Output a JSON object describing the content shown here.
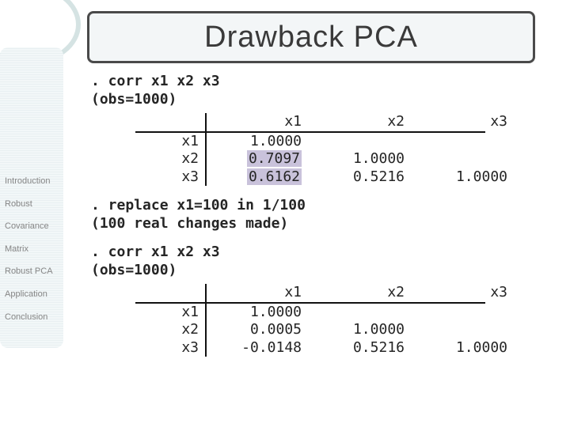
{
  "title": "Drawback PCA",
  "sidebar": {
    "items": [
      "Introduction",
      "Robust",
      "Covariance",
      "Matrix",
      "Robust PCA",
      "Application",
      "Conclusion"
    ]
  },
  "content": {
    "cmd1_line1": ". corr x1 x2 x3",
    "cmd1_line2": "(obs=1000)",
    "table1": {
      "col_headers": [
        "x1",
        "x2",
        "x3"
      ],
      "rows": [
        {
          "label": "x1",
          "vals": [
            "1.0000",
            "",
            ""
          ]
        },
        {
          "label": "x2",
          "vals": [
            "0.7097",
            "1.0000",
            ""
          ]
        },
        {
          "label": "x3",
          "vals": [
            "0.6162",
            "0.5216",
            "1.0000"
          ]
        }
      ],
      "highlight_cells": [
        "r1c0",
        "r2c0"
      ]
    },
    "cmd2_line1": ". replace x1=100 in 1/100",
    "cmd2_line2": "(100 real changes made)",
    "cmd3_line1": ". corr x1 x2 x3",
    "cmd3_line2": "(obs=1000)",
    "table2": {
      "col_headers": [
        "x1",
        "x2",
        "x3"
      ],
      "rows": [
        {
          "label": "x1",
          "vals": [
            "1.0000",
            "",
            ""
          ]
        },
        {
          "label": "x2",
          "vals": [
            "0.0005",
            "1.0000",
            ""
          ]
        },
        {
          "label": "x3",
          "vals": [
            "-0.0148",
            "0.5216",
            "1.0000"
          ]
        }
      ]
    }
  }
}
